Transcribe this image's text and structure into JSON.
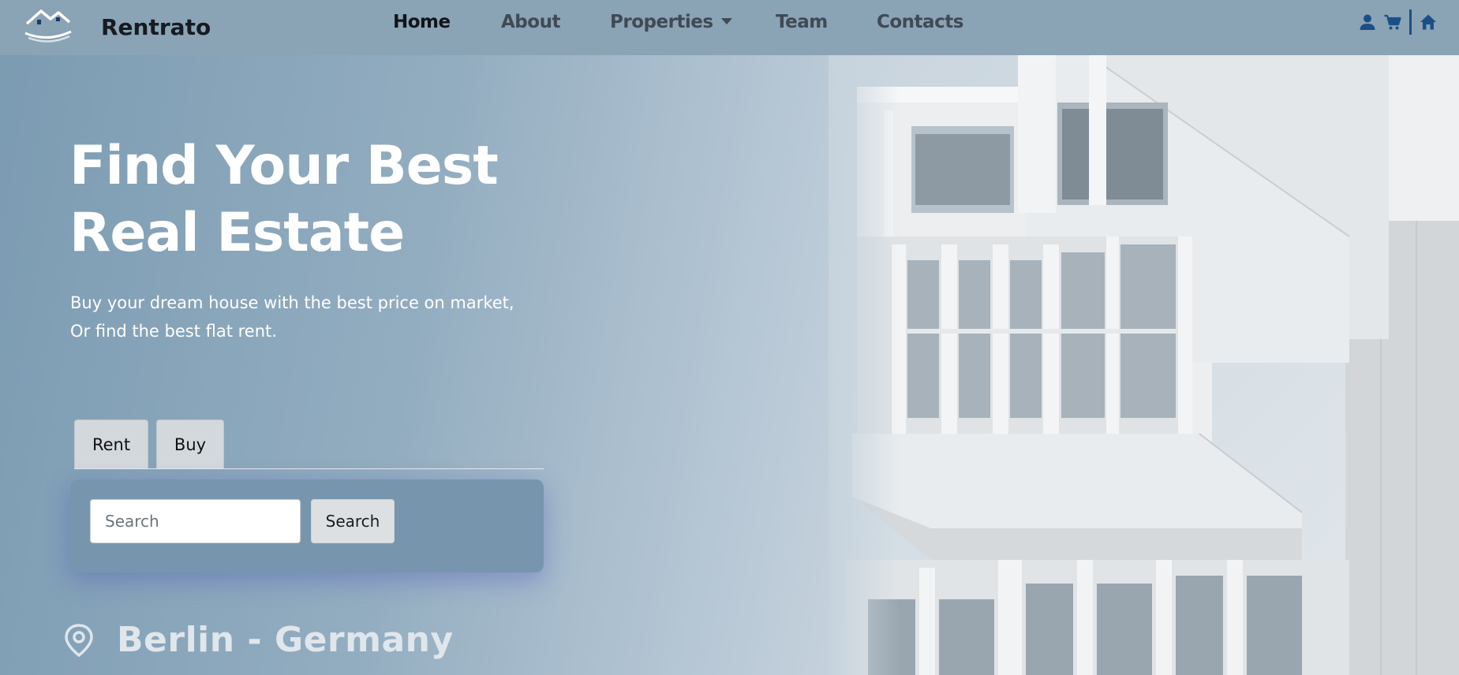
{
  "brand": {
    "name": "Rentrato",
    "logo_icon": "house-roof-logo-icon"
  },
  "nav": {
    "links": [
      {
        "label": "Home",
        "active": true
      },
      {
        "label": "About",
        "active": false
      },
      {
        "label": "Properties",
        "active": false,
        "has_dropdown": true
      },
      {
        "label": "Team",
        "active": false
      },
      {
        "label": "Contacts",
        "active": false
      }
    ],
    "icons": [
      "user-icon",
      "cart-icon",
      "home-icon"
    ]
  },
  "hero": {
    "title_line1": "Find Your Best",
    "title_line2": "Real Estate",
    "subtitle_line1": "Buy your dream house with the best price on market,",
    "subtitle_line2": "Or find the best flat rent."
  },
  "tabs": [
    {
      "label": "Rent"
    },
    {
      "label": "Buy"
    }
  ],
  "search": {
    "placeholder": "Search",
    "value": "",
    "button_label": "Search"
  },
  "location": {
    "text": "Berlin - Germany",
    "icon": "map-pin-icon"
  },
  "colors": {
    "navbar_bg": "#8aa3b5",
    "panel_bg": "#7796ae",
    "accent_blue": "#1c4f86",
    "hero_text": "#ffffff"
  }
}
